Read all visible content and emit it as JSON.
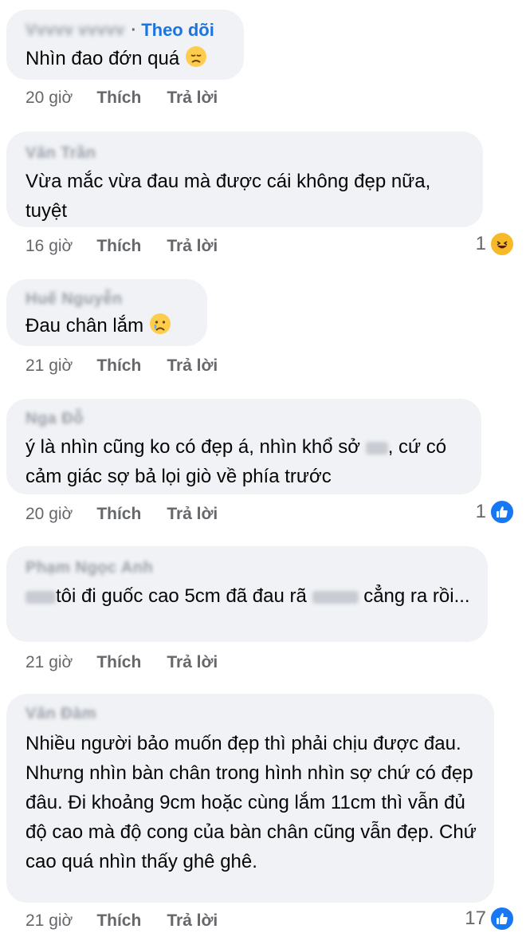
{
  "comments": [
    {
      "follow": "Theo dõi",
      "text": "Nhìn đao đớn quá",
      "time": "20 giờ",
      "like": "Thích",
      "reply": "Trả lời"
    },
    {
      "text": "Vừa mắc vừa đau mà được cái không đẹp nữa, tuyệt",
      "time": "16 giờ",
      "like": "Thích",
      "reply": "Trả lời",
      "reaction_count": "1",
      "reaction_icon": "haha-icon"
    },
    {
      "text": "Đau chân lắm",
      "time": "21 giờ",
      "like": "Thích",
      "reply": "Trả lời"
    },
    {
      "text_a": "ý là nhìn cũng ko có đẹp á, nhìn khổ sở",
      "text_b": ", cứ có cảm giác sợ bả lọi giò về phía trước",
      "time": "20 giờ",
      "like": "Thích",
      "reply": "Trả lời",
      "reaction_count": "1",
      "reaction_icon": "like-icon"
    },
    {
      "text_a": "tôi đi guốc cao 5cm đã đau rã",
      "text_b": "cẳng ra rồi...",
      "time": "21 giờ",
      "like": "Thích",
      "reply": "Trả lời"
    },
    {
      "text": "Nhiều người bảo muốn đẹp thì phải chịu được đau. Nhưng nhìn bàn chân trong hình nhìn sợ chứ có đẹp đâu. Đi khoảng 9cm hoặc cùng lắm 11cm thì vẫn đủ độ cao mà độ cong của bàn chân cũng vẫn đẹp. Chứ cao quá nhìn thấy ghê ghê.",
      "time": "21 giờ",
      "like": "Thích",
      "reply": "Trả lời",
      "reaction_count": "17",
      "reaction_icon": "like-icon"
    }
  ],
  "colors": {
    "bubble": "#f0f2f5",
    "text": "#050505",
    "meta": "#65676b",
    "follow": "#1b74e4",
    "like_blue": "#1877f2",
    "haha_yellow": "#f7b928"
  }
}
